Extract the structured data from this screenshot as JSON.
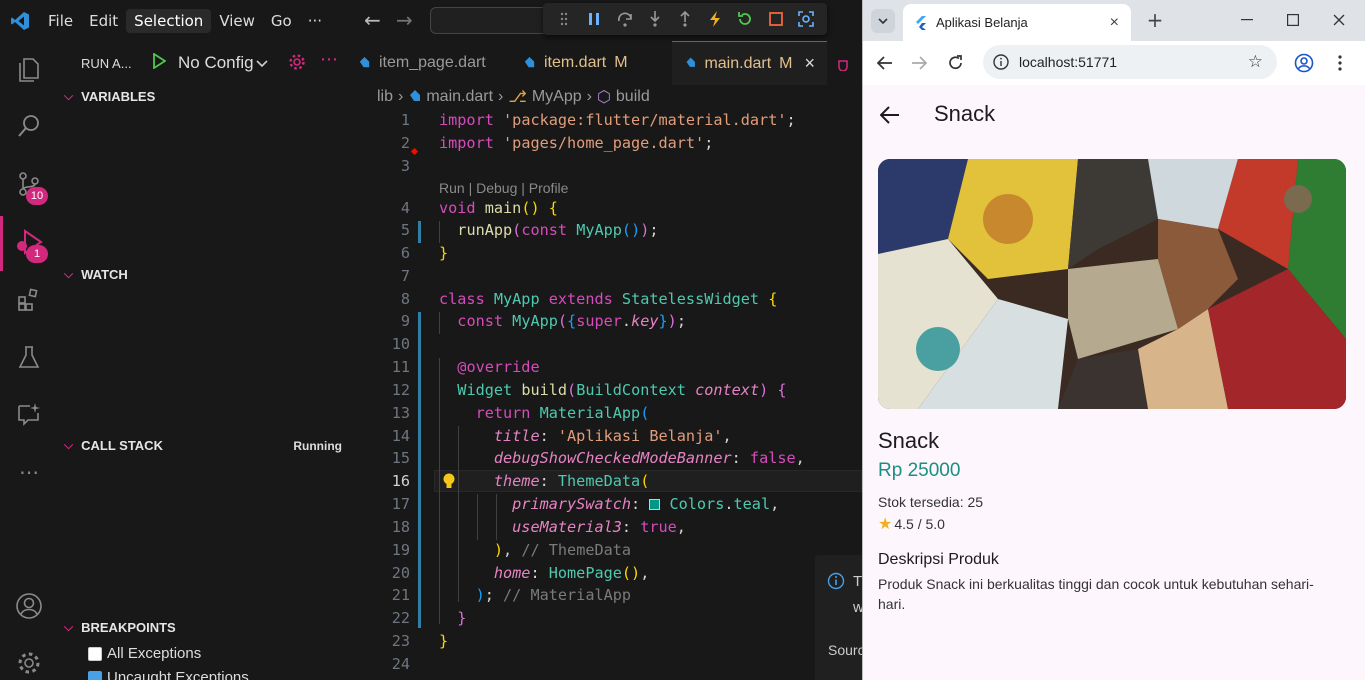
{
  "vscode": {
    "menu": [
      "File",
      "Edit",
      "Selection",
      "View",
      "Go",
      "···"
    ],
    "run_label": "RUN A...",
    "config_label": "No Config",
    "badges": {
      "source_control": "10",
      "debug": "1"
    },
    "sections": {
      "variables": "VARIABLES",
      "watch": "WATCH",
      "call_stack": "CALL STACK",
      "call_stack_status": "Running",
      "breakpoints": "BREAKPOINTS"
    },
    "breakpoint_options": [
      {
        "label": "All Exceptions",
        "checked": false
      },
      {
        "label": "Uncaught Exceptions",
        "checked": true
      }
    ],
    "tabs": [
      {
        "label": "item_page.dart",
        "modified": ""
      },
      {
        "label": "item.dart",
        "modified": "M"
      },
      {
        "label": "main.dart",
        "modified": "M"
      }
    ],
    "breadcrumb": [
      "lib",
      "main.dart",
      "MyApp",
      "build"
    ],
    "codelens": "Run | Debug | Profile",
    "line_numbers": [
      "1",
      "2",
      "3",
      "4",
      "5",
      "6",
      "7",
      "8",
      "9",
      "10",
      "11",
      "12",
      "13",
      "14",
      "15",
      "16",
      "17",
      "18",
      "19",
      "20",
      "21",
      "22",
      "23",
      "24"
    ],
    "notification_partial": {
      "line1": "T",
      "line2": "w",
      "line3": "Sourc"
    }
  },
  "browser": {
    "tab_title": "Aplikasi Belanja",
    "url": "localhost:51771"
  },
  "app": {
    "appbar_title": "Snack",
    "product_name": "Snack",
    "price": "Rp 25000",
    "stock": "Stok tersedia: 25",
    "rating": "4.5 / 5.0",
    "desc_title": "Deskripsi Produk",
    "desc_text": "Produk Snack ini berkualitas tinggi dan cocok untuk kebutuhan sehari-hari."
  },
  "colors": {
    "accent_pink": "#d2297e",
    "teal": "#1a8f80",
    "app_bg": "#fdf7fd"
  }
}
